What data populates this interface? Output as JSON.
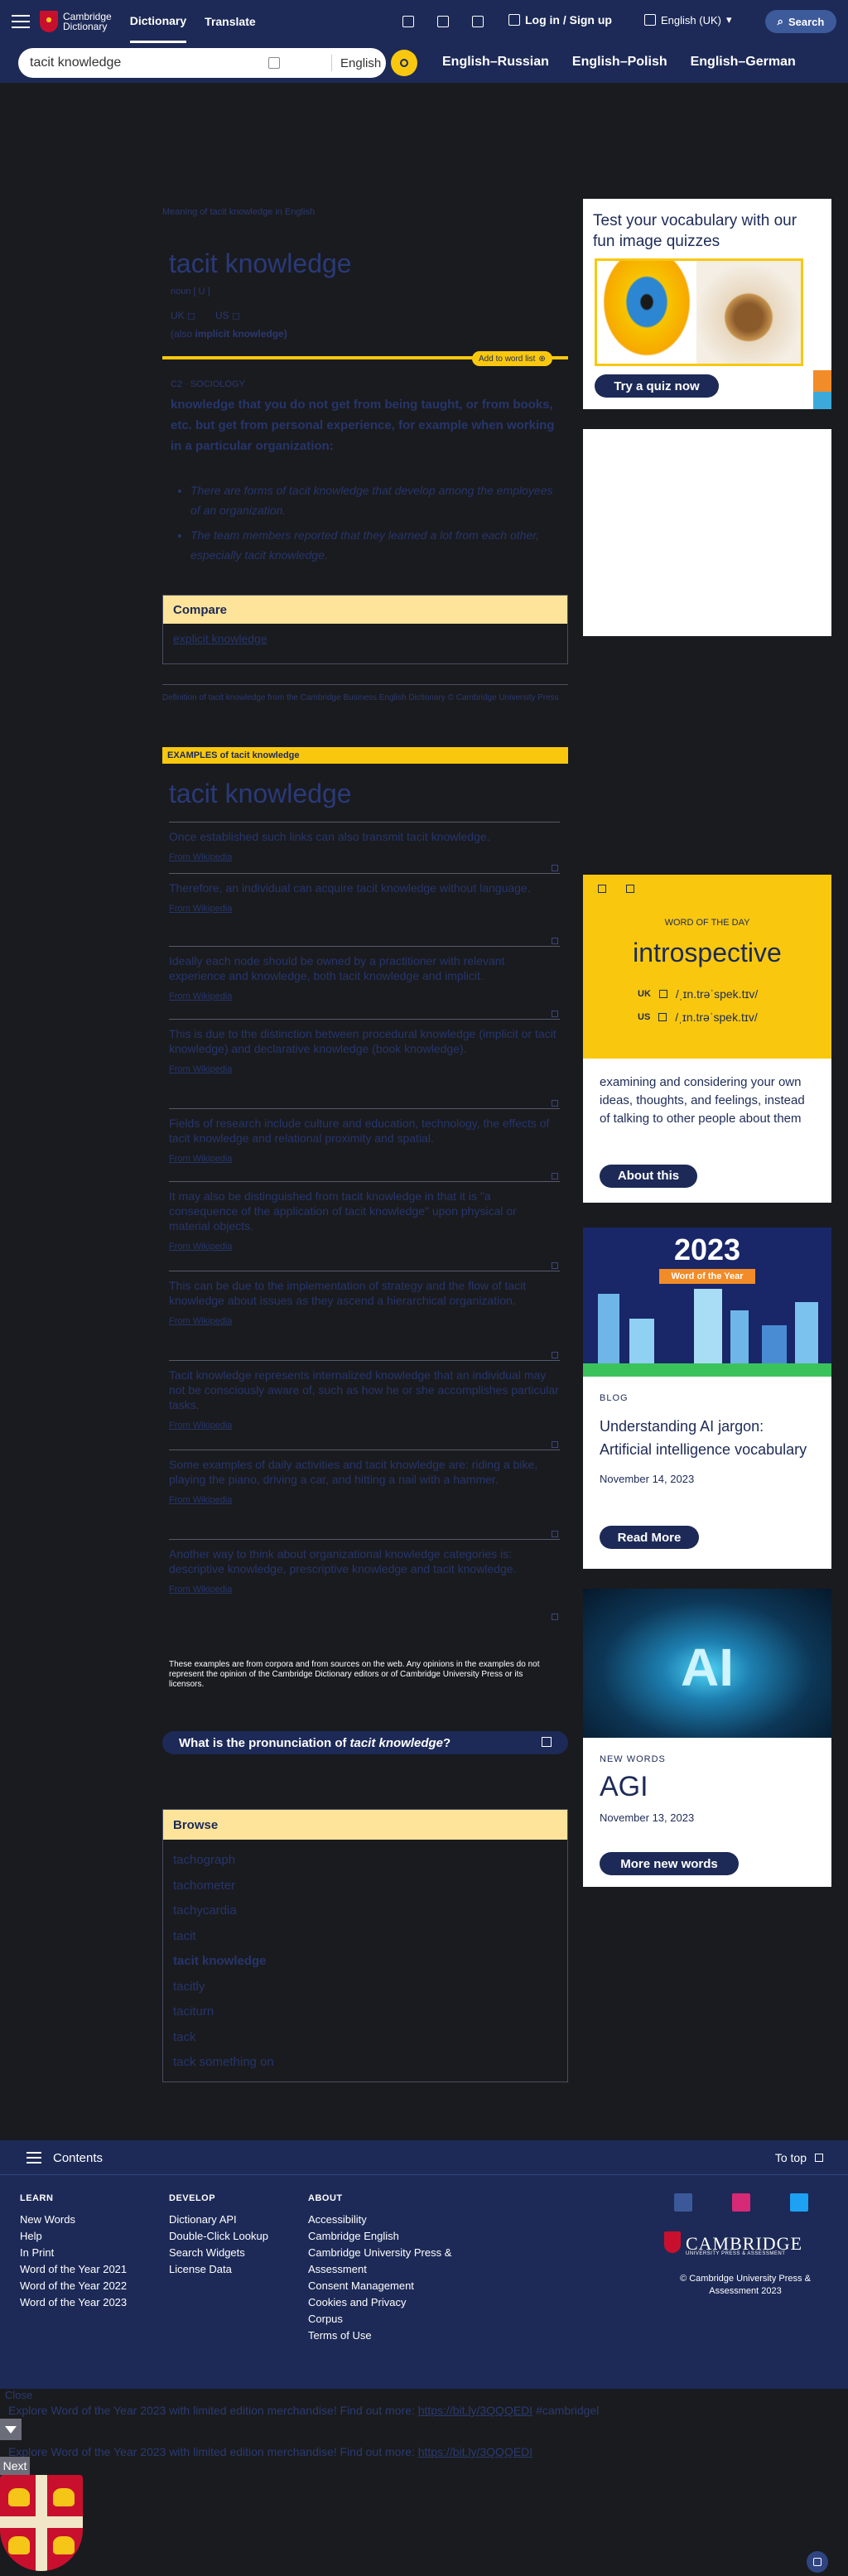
{
  "header": {
    "logo_line1": "Cambridge",
    "logo_line2": "Dictionary",
    "nav": [
      "Dictionary",
      "Translate"
    ],
    "login": "Log in / Sign up",
    "language": "English (UK)",
    "search": "Search"
  },
  "searchbar": {
    "query": "tacit knowledge",
    "dictionary": "English",
    "quick_links": [
      "English–Russian",
      "English–Polish",
      "English–German"
    ]
  },
  "entry": {
    "breadcrumb": "Meaning of tacit knowledge in English",
    "headword": "tacit knowledge",
    "pos": "noun [ U ]",
    "uk": "UK",
    "us": "US",
    "also_label": "(also",
    "also_word": "implicit knowledge)",
    "add_to_list": "Add to word list",
    "level": "C2 · SOCIOLOGY",
    "definition": "knowledge that you do not get from being taught, or from books, etc. but get from personal experience, for example when working in a particular organization:",
    "examples": [
      "There are forms of tacit knowledge that develop among the employees of an organization.",
      "The team members reported that they learned a lot from each other, especially tacit knowledge."
    ],
    "compare_title": "Compare",
    "compare_link": "explicit knowledge",
    "source": "Definition of tacit knowledge from the Cambridge Business English Dictionary © Cambridge University Press"
  },
  "examples_section": {
    "header": "EXAMPLES of tacit knowledge",
    "title": "tacit knowledge",
    "items": [
      {
        "text": "Once established such links can also transmit tacit knowledge.",
        "from": "From Wikipedia"
      },
      {
        "text": "Therefore, an individual can acquire tacit knowledge without language.",
        "from": "From Wikipedia"
      },
      {
        "text": "Ideally each node should be owned by a practitioner with relevant experience and knowledge, both tacit knowledge and implicit.",
        "from": "From Wikipedia"
      },
      {
        "text": "This is due to the distinction between procedural knowledge (implicit or tacit knowledge) and declarative knowledge (book knowledge).",
        "from": "From Wikipedia"
      },
      {
        "text": "Fields of research include culture and education, technology, the effects of tacit knowledge and relational proximity and spatial.",
        "from": "From Wikipedia"
      },
      {
        "text": "It may also be distinguished from tacit knowledge in that it is \"a consequence of the application of tacit knowledge\" upon physical or material objects.",
        "from": "From Wikipedia"
      },
      {
        "text": "This can be due to the implementation of strategy and the flow of tacit knowledge about issues as they ascend a hierarchical organization.",
        "from": "From Wikipedia"
      },
      {
        "text": "Tacit knowledge represents internalized knowledge that an individual may not be consciously aware of, such as how he or she accomplishes particular tasks.",
        "from": "From Wikipedia"
      },
      {
        "text": "Some examples of daily activities and tacit knowledge are: riding a bike, playing the piano, driving a car, and hitting a nail with a hammer.",
        "from": "From Wikipedia"
      },
      {
        "text": "Another way to think about organizational knowledge categories is: descriptive knowledge, prescriptive knowledge and tacit knowledge.",
        "from": "From Wikipedia"
      }
    ],
    "disclaimer": "These examples are from corpora and from sources on the web. Any opinions in the examples do not represent the opinion of the Cambridge Dictionary editors or of Cambridge University Press or its licensors."
  },
  "pronunciation": {
    "prefix": "What is the pronunciation of",
    "word": "tacit knowledge",
    "suffix": "?"
  },
  "browse": {
    "title": "Browse",
    "items": [
      "tachograph",
      "tachometer",
      "tachycardia",
      "tacit",
      "tacit knowledge",
      "tacitly",
      "taciturn",
      "tack",
      "tack something on"
    ],
    "current_index": 4
  },
  "quiz": {
    "title": "Test your vocabulary with our fun image quizzes",
    "button": "Try a quiz now"
  },
  "wotd": {
    "label": "WORD OF THE DAY",
    "word": "introspective",
    "uk": "UK",
    "us": "US",
    "uk_ipa": "/ˌɪn.trəˈspek.tɪv/",
    "us_ipa": "/ˌɪn.trəˈspek.tɪv/",
    "definition": "examining and considering your own ideas, thoughts, and feelings, instead of talking to other people about them",
    "button": "About this"
  },
  "blog": {
    "image_year": "2023",
    "image_tag": "Word of the Year",
    "tag": "BLOG",
    "title": "Understanding AI jargon: Artificial intelligence vocabulary",
    "date": "November 14, 2023",
    "button": "Read More"
  },
  "new_words": {
    "image_text": "AI",
    "tag": "NEW WORDS",
    "word": "AGI",
    "date": "November 13, 2023",
    "button": "More new words"
  },
  "footer": {
    "contents": "Contents",
    "to_top": "To top",
    "learn": {
      "title": "LEARN",
      "links": [
        "New Words",
        "Help",
        "In Print",
        "Word of the Year 2021",
        "Word of the Year 2022",
        "Word of the Year 2023"
      ]
    },
    "develop": {
      "title": "DEVELOP",
      "links": [
        "Dictionary API",
        "Double-Click Lookup",
        "Search Widgets",
        "License Data"
      ]
    },
    "about": {
      "title": "ABOUT",
      "links": [
        "Accessibility",
        "Cambridge English",
        "Cambridge University Press & Assessment",
        "Consent Management",
        "Cookies and Privacy",
        "Corpus",
        "Terms of Use"
      ]
    },
    "cambridge": "CAMBRIDGE",
    "cambridge_sub": "UNIVERSITY PRESS & ASSESSMENT",
    "copyright": "© Cambridge University Press & Assessment 2023"
  },
  "below": {
    "close": "Close",
    "promo1_text": "Explore Word of the Year 2023 with limited edition merchandise! Find out more:",
    "promo1_link": "https://bit.ly/3QQQEDI",
    "promo1_tail": "#cambridgel",
    "promo2_text": "Explore Word of the Year 2023 with limited edition merchandise! Find out more:",
    "promo2_link": "https://bit.ly/3QQQEDI",
    "next": "Next"
  },
  "colors": {
    "navy": "#1d2a57",
    "yellow": "#f9c80e",
    "pale_yellow": "#fde49a",
    "page_bg": "#1a1b1f"
  }
}
